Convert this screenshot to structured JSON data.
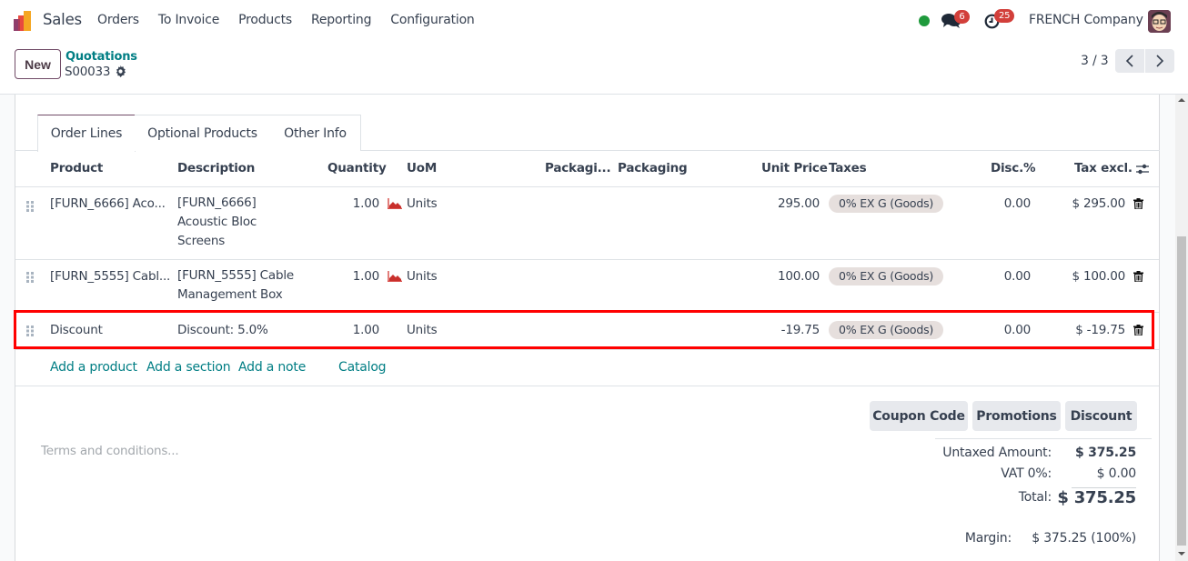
{
  "navbar": {
    "app_name": "Sales",
    "menu": [
      "Orders",
      "To Invoice",
      "Products",
      "Reporting",
      "Configuration"
    ],
    "status_color": "#1f9a3c",
    "messages_count": "6",
    "activities_count": "25",
    "company": "FRENCH Company"
  },
  "control_panel": {
    "new_label": "New",
    "breadcrumb": "Quotations",
    "record_name": "S00033",
    "pager": "3 / 3"
  },
  "tabs": [
    {
      "label": "Order Lines",
      "active": true
    },
    {
      "label": "Optional Products",
      "active": false
    },
    {
      "label": "Other Info",
      "active": false
    }
  ],
  "table": {
    "headers": {
      "product": "Product",
      "description": "Description",
      "quantity": "Quantity",
      "uom": "UoM",
      "packaging_qty": "Packagi...",
      "packaging": "Packaging",
      "unit_price": "Unit Price",
      "taxes": "Taxes",
      "discount": "Disc.%",
      "subtotal": "Tax excl."
    },
    "rows": [
      {
        "product": "[FURN_6666] Aco...",
        "description": [
          "[FURN_6666]",
          "Acoustic Bloc",
          "Screens"
        ],
        "quantity": "1.00",
        "forecast_icon": true,
        "uom": "Units",
        "unit_price": "295.00",
        "taxes": "0% EX G (Goods)",
        "discount": "0.00",
        "subtotal": "$ 295.00"
      },
      {
        "product": "[FURN_5555] Cabl...",
        "description": [
          "[FURN_5555] Cable",
          "Management Box"
        ],
        "quantity": "1.00",
        "forecast_icon": true,
        "uom": "Units",
        "unit_price": "100.00",
        "taxes": "0% EX G (Goods)",
        "discount": "0.00",
        "subtotal": "$ 100.00"
      },
      {
        "product": "Discount",
        "description": [
          "Discount: 5.0%"
        ],
        "quantity": "1.00",
        "forecast_icon": false,
        "uom": "Units",
        "unit_price": "-19.75",
        "taxes": "0% EX G (Goods)",
        "discount": "0.00",
        "subtotal": "$ -19.75",
        "highlighted": true
      }
    ],
    "add_links": {
      "add_product": "Add a product",
      "add_section": "Add a section",
      "add_note": "Add a note",
      "catalog": "Catalog"
    }
  },
  "footer": {
    "terms_placeholder": "Terms and conditions...",
    "buttons": {
      "coupon": "Coupon Code",
      "promotions": "Promotions",
      "discount": "Discount"
    },
    "totals": {
      "untaxed_label": "Untaxed Amount:",
      "untaxed_value": "$ 375.25",
      "vat_label": "VAT 0%:",
      "vat_value": "$ 0.00",
      "total_label": "Total:",
      "total_value": "$ 375.25",
      "margin_label": "Margin:",
      "margin_value": "$ 375.25 (100%)"
    }
  },
  "colors": {
    "brand": "#714b67",
    "link": "#017e84",
    "highlight": "#ff0000",
    "badge": "#d23f3a"
  }
}
